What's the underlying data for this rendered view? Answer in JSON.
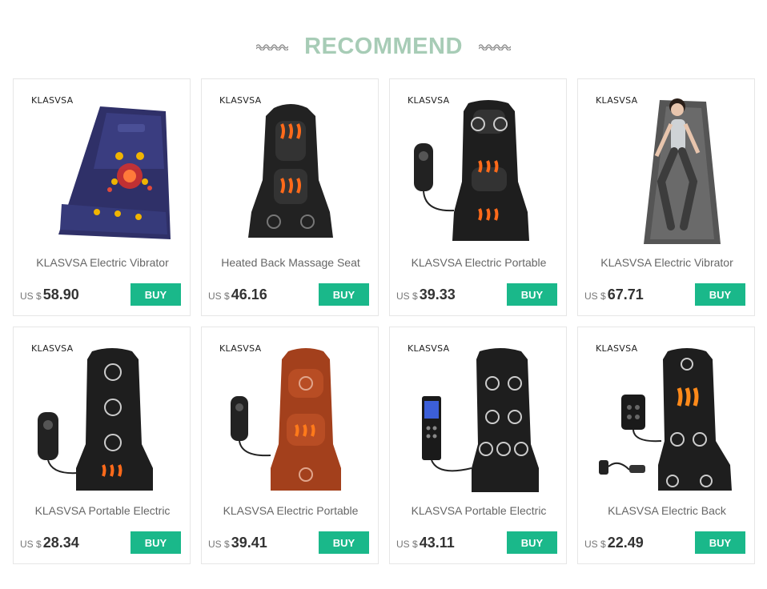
{
  "header": {
    "title": "RECOMMEND"
  },
  "products": [
    {
      "brand": "KLASVSA",
      "name": "KLASVSA Electric Vibrator",
      "currency": "US $",
      "price": "58.90",
      "buy": "BUY",
      "image": "mattress-massager"
    },
    {
      "brand": "KLASVSA",
      "name": "Heated Back Massage Seat",
      "currency": "US $",
      "price": "46.16",
      "buy": "BUY",
      "image": "seat-massager"
    },
    {
      "brand": "KLASVSA",
      "name": "KLASVSA Electric Portable",
      "currency": "US $",
      "price": "39.33",
      "buy": "BUY",
      "image": "seat-massager-remote"
    },
    {
      "brand": "KLASVSA",
      "name": "KLASVSA Electric Vibrator",
      "currency": "US $",
      "price": "67.71",
      "buy": "BUY",
      "image": "mattress-with-woman"
    },
    {
      "brand": "KLASVSA",
      "name": "KLASVSA Portable Electric",
      "currency": "US $",
      "price": "28.34",
      "buy": "BUY",
      "image": "seat-massager-remote"
    },
    {
      "brand": "KLASVSA",
      "name": "KLASVSA Electric Portable",
      "currency": "US $",
      "price": "39.41",
      "buy": "BUY",
      "image": "brown-seat-massager"
    },
    {
      "brand": "KLASVSA",
      "name": "KLASVSA Portable Electric",
      "currency": "US $",
      "price": "43.11",
      "buy": "BUY",
      "image": "seat-massager-lcd-remote"
    },
    {
      "brand": "KLASVSA",
      "name": "KLASVSA Electric Back",
      "currency": "US $",
      "price": "22.49",
      "buy": "BUY",
      "image": "seat-massager-adapter"
    }
  ],
  "colors": {
    "accent": "#1ab88a",
    "title": "#a7ccb6"
  }
}
